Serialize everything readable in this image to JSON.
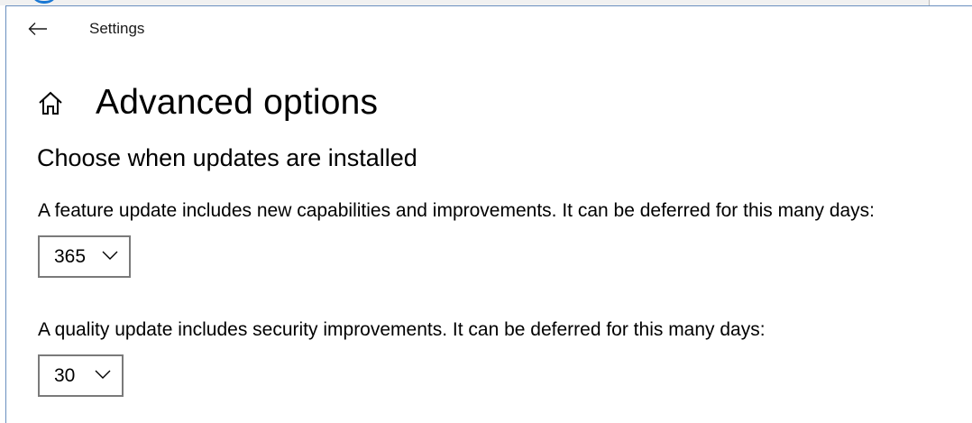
{
  "window": {
    "title": "Settings"
  },
  "page": {
    "title": "Advanced options",
    "section_heading": "Choose when updates are installed"
  },
  "feature_update": {
    "description": "A feature update includes new capabilities and improvements. It can be deferred for this many days:",
    "selected_value": "365"
  },
  "quality_update": {
    "description": "A quality update includes security improvements. It can be deferred for this many days:",
    "selected_value": "30"
  },
  "icons": {
    "back": "back-arrow-icon",
    "home": "home-icon",
    "dropdown": "chevron-down-icon"
  },
  "colors": {
    "frame": "#6a8fbf",
    "dropdown_border": "#7a7a7a",
    "accent": "#1a78d4"
  }
}
